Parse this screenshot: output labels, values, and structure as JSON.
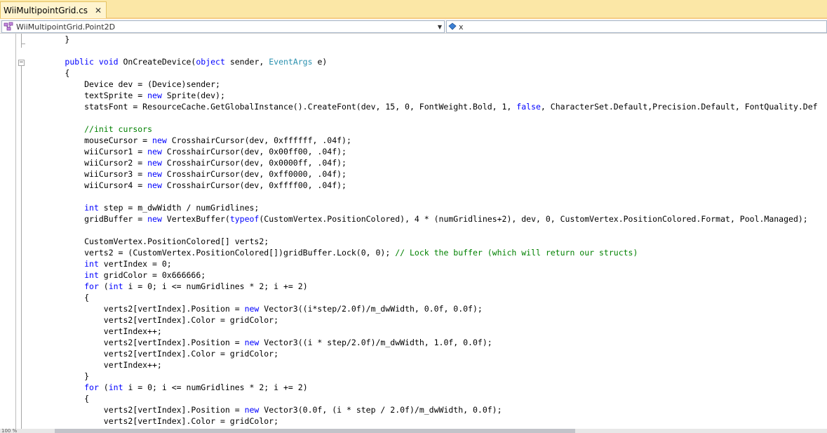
{
  "tab": {
    "title": "WiiMultipointGrid.cs",
    "close_glyph": "✕"
  },
  "navbar": {
    "class_selector": "WiiMultipointGrid.Point2D",
    "member_selector": "x"
  },
  "statusbar": {
    "zoom": "100 %"
  },
  "colors": {
    "keyword": "#0000ff",
    "type": "#2b91af",
    "comment": "#008000"
  },
  "code_lines": [
    [
      {
        "t": "        }"
      }
    ],
    [
      {
        "t": ""
      }
    ],
    [
      {
        "t": "        "
      },
      {
        "t": "public",
        "c": "kw"
      },
      {
        "t": " "
      },
      {
        "t": "void",
        "c": "kw"
      },
      {
        "t": " OnCreateDevice("
      },
      {
        "t": "object",
        "c": "kw"
      },
      {
        "t": " sender, "
      },
      {
        "t": "EventArgs",
        "c": "ty"
      },
      {
        "t": " e)"
      }
    ],
    [
      {
        "t": "        {"
      }
    ],
    [
      {
        "t": "            Device dev = (Device)sender;"
      }
    ],
    [
      {
        "t": "            textSprite = "
      },
      {
        "t": "new",
        "c": "kw"
      },
      {
        "t": " Sprite(dev);"
      }
    ],
    [
      {
        "t": "            statsFont = ResourceCache.GetGlobalInstance().CreateFont(dev, 15, 0, FontWeight.Bold, 1, "
      },
      {
        "t": "false",
        "c": "kw"
      },
      {
        "t": ", CharacterSet.Default,Precision.Default, FontQuality.Def"
      }
    ],
    [
      {
        "t": ""
      }
    ],
    [
      {
        "t": "            "
      },
      {
        "t": "//init cursors",
        "c": "cm"
      }
    ],
    [
      {
        "t": "            mouseCursor = "
      },
      {
        "t": "new",
        "c": "kw"
      },
      {
        "t": " CrosshairCursor(dev, 0xffffff, .04f);"
      }
    ],
    [
      {
        "t": "            wiiCursor1 = "
      },
      {
        "t": "new",
        "c": "kw"
      },
      {
        "t": " CrosshairCursor(dev, 0x00ff00, .04f);"
      }
    ],
    [
      {
        "t": "            wiiCursor2 = "
      },
      {
        "t": "new",
        "c": "kw"
      },
      {
        "t": " CrosshairCursor(dev, 0x0000ff, .04f);"
      }
    ],
    [
      {
        "t": "            wiiCursor3 = "
      },
      {
        "t": "new",
        "c": "kw"
      },
      {
        "t": " CrosshairCursor(dev, 0xff0000, .04f);"
      }
    ],
    [
      {
        "t": "            wiiCursor4 = "
      },
      {
        "t": "new",
        "c": "kw"
      },
      {
        "t": " CrosshairCursor(dev, 0xffff00, .04f);"
      }
    ],
    [
      {
        "t": ""
      }
    ],
    [
      {
        "t": "            "
      },
      {
        "t": "int",
        "c": "kw"
      },
      {
        "t": " step = m_dwWidth / numGridlines;"
      }
    ],
    [
      {
        "t": "            gridBuffer = "
      },
      {
        "t": "new",
        "c": "kw"
      },
      {
        "t": " VertexBuffer("
      },
      {
        "t": "typeof",
        "c": "kw"
      },
      {
        "t": "(CustomVertex.PositionColored), 4 * (numGridlines+2), dev, 0, CustomVertex.PositionColored.Format, Pool.Managed);"
      }
    ],
    [
      {
        "t": ""
      }
    ],
    [
      {
        "t": "            CustomVertex.PositionColored[] verts2;"
      }
    ],
    [
      {
        "t": "            verts2 = (CustomVertex.PositionColored[])gridBuffer.Lock(0, 0); "
      },
      {
        "t": "// Lock the buffer (which will return our structs)",
        "c": "cm"
      }
    ],
    [
      {
        "t": "            "
      },
      {
        "t": "int",
        "c": "kw"
      },
      {
        "t": " vertIndex = 0;"
      }
    ],
    [
      {
        "t": "            "
      },
      {
        "t": "int",
        "c": "kw"
      },
      {
        "t": " gridColor = 0x666666;"
      }
    ],
    [
      {
        "t": "            "
      },
      {
        "t": "for",
        "c": "kw"
      },
      {
        "t": " ("
      },
      {
        "t": "int",
        "c": "kw"
      },
      {
        "t": " i = 0; i <= numGridlines * 2; i += 2)"
      }
    ],
    [
      {
        "t": "            {"
      }
    ],
    [
      {
        "t": "                verts2[vertIndex].Position = "
      },
      {
        "t": "new",
        "c": "kw"
      },
      {
        "t": " Vector3((i*step/2.0f)/m_dwWidth, 0.0f, 0.0f);"
      }
    ],
    [
      {
        "t": "                verts2[vertIndex].Color = gridColor;"
      }
    ],
    [
      {
        "t": "                vertIndex++;"
      }
    ],
    [
      {
        "t": "                verts2[vertIndex].Position = "
      },
      {
        "t": "new",
        "c": "kw"
      },
      {
        "t": " Vector3((i * step/2.0f)/m_dwWidth, 1.0f, 0.0f);"
      }
    ],
    [
      {
        "t": "                verts2[vertIndex].Color = gridColor;"
      }
    ],
    [
      {
        "t": "                vertIndex++;"
      }
    ],
    [
      {
        "t": "            }"
      }
    ],
    [
      {
        "t": "            "
      },
      {
        "t": "for",
        "c": "kw"
      },
      {
        "t": " ("
      },
      {
        "t": "int",
        "c": "kw"
      },
      {
        "t": " i = 0; i <= numGridlines * 2; i += 2)"
      }
    ],
    [
      {
        "t": "            {"
      }
    ],
    [
      {
        "t": "                verts2[vertIndex].Position = "
      },
      {
        "t": "new",
        "c": "kw"
      },
      {
        "t": " Vector3(0.0f, (i * step / 2.0f)/m_dwWidth, 0.0f);"
      }
    ],
    [
      {
        "t": "                verts2[vertIndex].Color = gridColor;"
      }
    ]
  ]
}
